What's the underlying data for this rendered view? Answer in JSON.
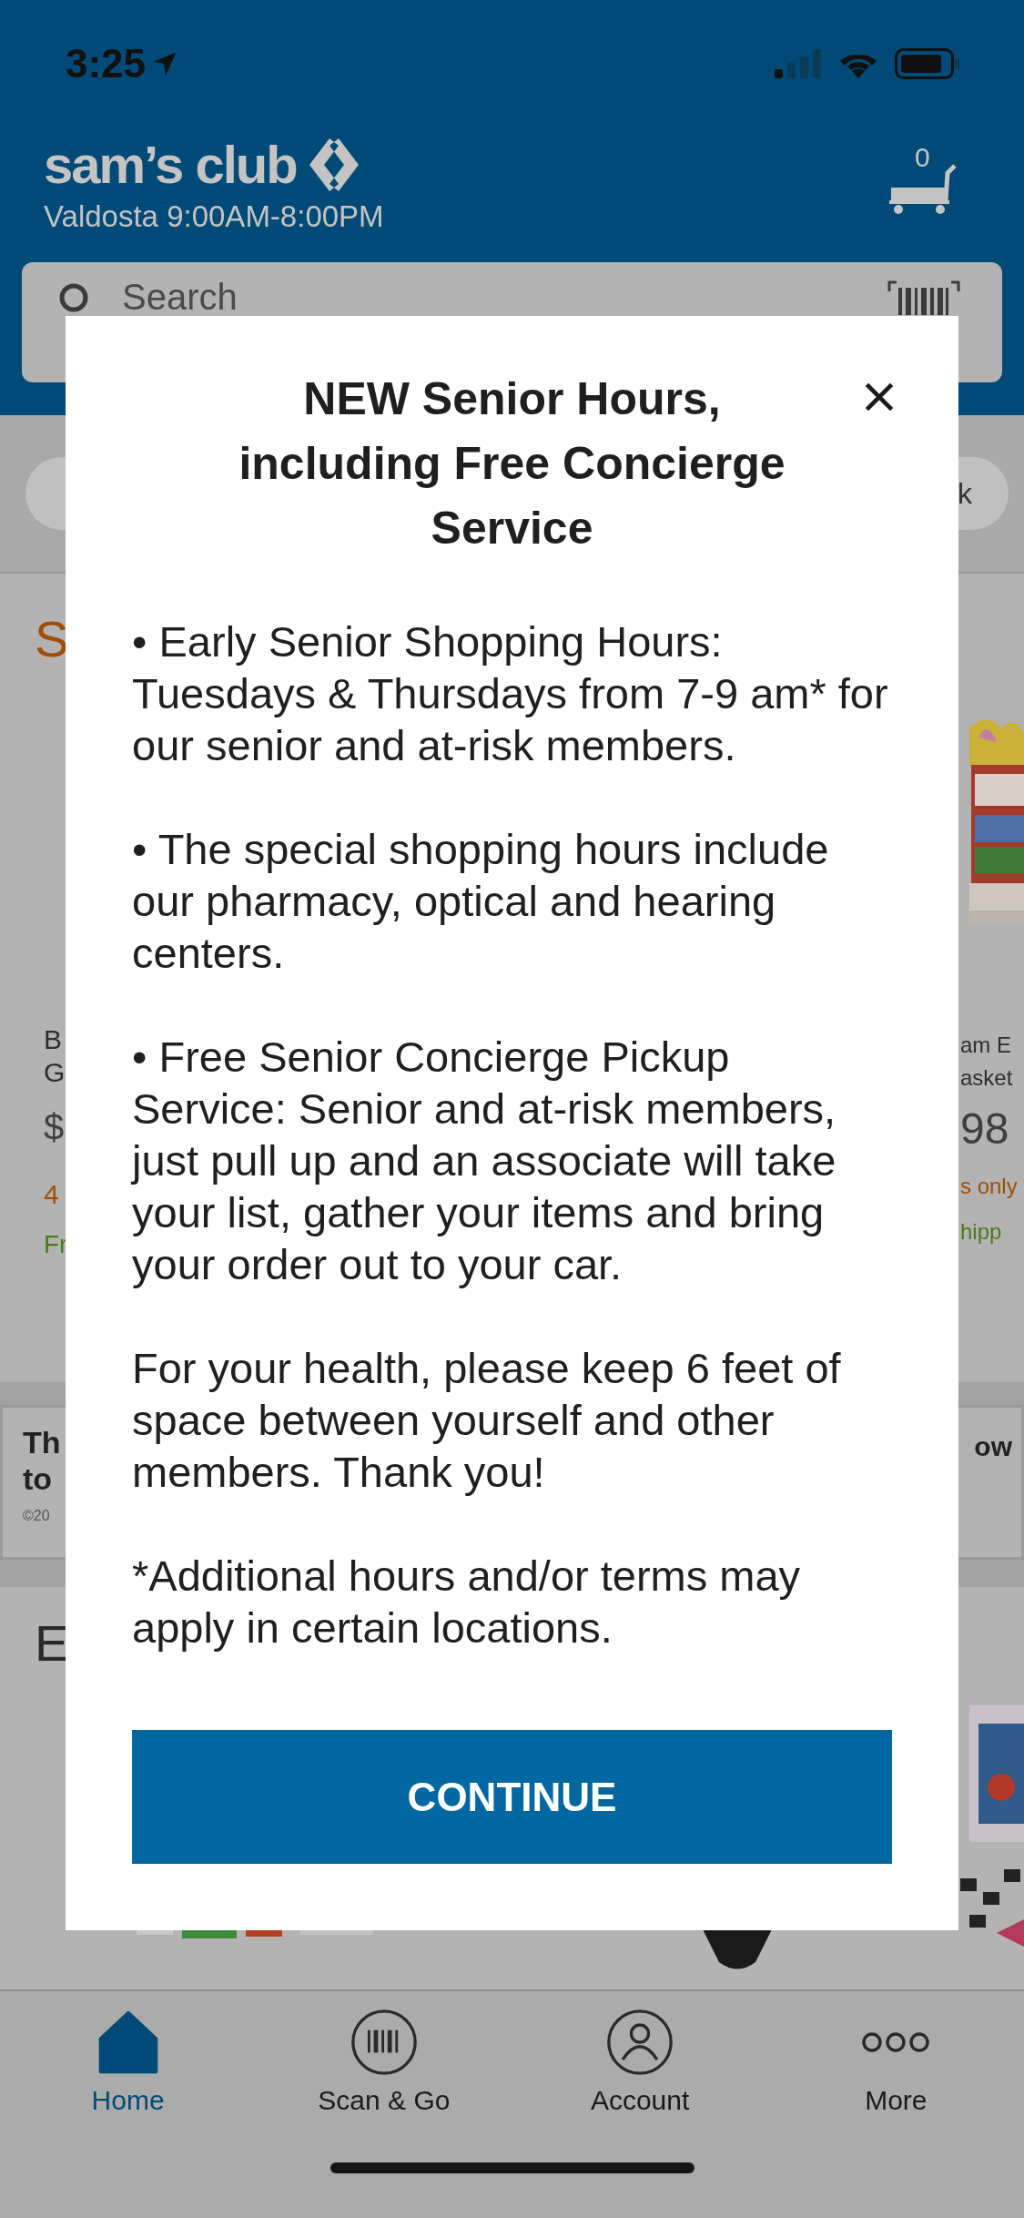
{
  "status_bar": {
    "time": "3:25"
  },
  "header": {
    "logo": "sam’s club",
    "store_hours": "Valdosta 9:00AM-8:00PM",
    "cart_count": "0",
    "search": {
      "placeholder": "Search"
    }
  },
  "filter_chips": [
    {
      "label": "k"
    }
  ],
  "featured_section": {
    "title": "S",
    "left_product": {
      "name_lines": [
        "B",
        "G"
      ],
      "price": "$",
      "note": "4",
      "shipping": "Fr"
    },
    "right_product": {
      "name_lines": [
        "am E",
        "asket"
      ],
      "price": "98",
      "note": "s only",
      "shipping": "hipp"
    }
  },
  "banner": {
    "left_lines": [
      "Th",
      "to"
    ],
    "copyright": "©20",
    "right_text": "ow"
  },
  "second_section": {
    "title": "E"
  },
  "modal": {
    "title": "NEW Senior Hours, including Free Concierge Service",
    "paragraphs": [
      "• Early Senior Shopping Hours: Tuesdays & Thursdays from 7-9 am* for our senior and at-risk members.",
      "• The special shopping hours include our pharmacy, optical and hearing centers.",
      "• Free Senior Concierge Pickup Service: Senior and at-risk members, just pull up and an associate will take your list, gather your items and bring your order out to your car.",
      "For your health, please keep 6 feet of space between yourself and other members. Thank you!",
      "*Additional hours and/or terms may apply in certain locations."
    ],
    "button": "CONTINUE"
  },
  "tab_bar": [
    {
      "kind": "home",
      "label": "Home",
      "selected": true
    },
    {
      "kind": "scan",
      "label": "Scan & Go",
      "selected": false
    },
    {
      "kind": "account",
      "label": "Account",
      "selected": false
    },
    {
      "kind": "more",
      "label": "More",
      "selected": false
    }
  ]
}
